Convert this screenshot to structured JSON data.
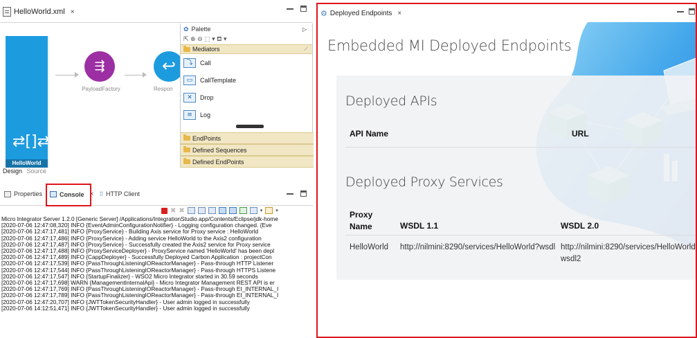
{
  "editor": {
    "tab_title": "HelloWorld.xml",
    "close_glyph": "×",
    "api_label": "HelloWorld",
    "api_symbol": "⇄[]⇄",
    "payload_factory_label": "PayloadFactory",
    "respond_label": "Respon",
    "design_tab": "Design",
    "source_tab": "Source",
    "palette": {
      "title": "Palette",
      "tools": "⇱ ⊕ ⊖ ⬚ ▾ ⛾ ▾",
      "mediators_section": "Mediators",
      "items": [
        "Call",
        "CallTemplate",
        "Drop",
        "Log"
      ],
      "footer_sections": [
        "EndPoints",
        "Defined Sequences",
        "Defined EndPoints"
      ]
    }
  },
  "console": {
    "tabs": {
      "properties": "Properties",
      "console": "Console",
      "http_client": "HTTP Client"
    },
    "lines": [
      "Micro Integrator Server 1.2.0 [Generic Server] /Applications/IntegrationStudio.app/Contents/Eclipse/jdk-home",
      "[2020-07-06 12:47:08,320]  INFO {EventAdminConfigurationNotifier} - Logging configuration changed. {Eve",
      "[2020-07-06 12:47:17,481]  INFO {ProxyService} - Building Axis service for Proxy service : HelloWorld",
      "[2020-07-06 12:47:17,486]  INFO {ProxyService} - Adding service HelloWorld to the Axis2 configuration",
      "[2020-07-06 12:47:17,487]  INFO {ProxyService} - Successfully created the Axis2 service for Proxy service",
      "[2020-07-06 12:47:17,488]  INFO {ProxyServiceDeployer} - ProxyService named 'HelloWorld' has been depl",
      "[2020-07-06 12:47:17,489]  INFO {CappDeployer} - Successfully Deployed Carbon Application : projectCon",
      "[2020-07-06 12:47:17,539]  INFO {PassThroughListeningIOReactorManager} - Pass-through HTTP Listener",
      "[2020-07-06 12:47:17,544]  INFO {PassThroughListeningIOReactorManager} - Pass-through HTTPS Listene",
      "[2020-07-06 12:47:17,547]  INFO {StartupFinalizer} - WSO2 Micro Integrator started in 30.59 seconds",
      "[2020-07-06 12:47:17,698]  WARN {ManagementInternalApi} - Micro Integrator Management REST API is er",
      "[2020-07-06 12:47:17,769]  INFO {PassThroughListeningIOReactorManager} - Pass-through EI_INTERNAL_I",
      "[2020-07-06 12:47:17,789]  INFO {PassThroughListeningIOReactorManager} - Pass-through EI_INTERNAL_I",
      "[2020-07-06 12:47:20,707]  INFO {JWTTokenSecurityHandler} - User admin logged in successfully",
      "[2020-07-06 14:12:51,471]  INFO {JWTTokenSecurityHandler} - User admin logged in successfully"
    ]
  },
  "endpoints": {
    "tab_title": "Deployed Endpoints",
    "close_glyph": "×",
    "page_title": "Embedded MI Deployed Endpoints",
    "apis": {
      "title": "Deployed APIs",
      "headers": [
        "API Name",
        "URL"
      ]
    },
    "proxies": {
      "title": "Deployed Proxy Services",
      "headers": [
        "Proxy Name",
        "WSDL 1.1",
        "WSDL 2.0"
      ],
      "rows": [
        {
          "name": "HelloWorld",
          "wsdl11": "http://nilmini:8290/services/HelloWorld?wsdl",
          "wsdl20": "http://nilmini:8290/services/HelloWorld?wsdl2"
        }
      ]
    },
    "colors": {
      "accent_blue": "#1d9bdf",
      "highlight_red": "#e0141b",
      "cube_teal": "#6fd3c4"
    }
  }
}
